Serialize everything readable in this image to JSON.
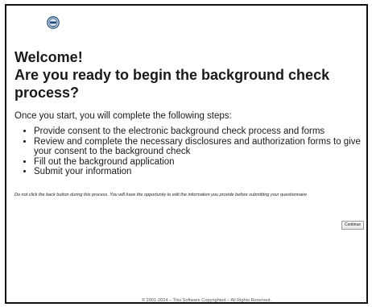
{
  "page": {
    "welcome": "Welcome!",
    "question": "Are you ready to begin the background check process?",
    "intro": "Once you start, you will complete the following steps:",
    "steps": [
      "Provide consent to the electronic background check process and forms",
      "Review and complete the necessary disclosures and authorization forms to give your consent to the background check",
      "Fill out the background application",
      "Submit your information"
    ],
    "note": "Do not click the back button during this process. You will have the opportunity to edit the information you provide before submitting your questionnaire",
    "continue_label": "Continue",
    "footer": "© 2001-2024 – This Software Copyrighted – All Rights Reserved."
  },
  "logo": {
    "icon": "seal-logo-icon",
    "color": "#1f4e79"
  }
}
